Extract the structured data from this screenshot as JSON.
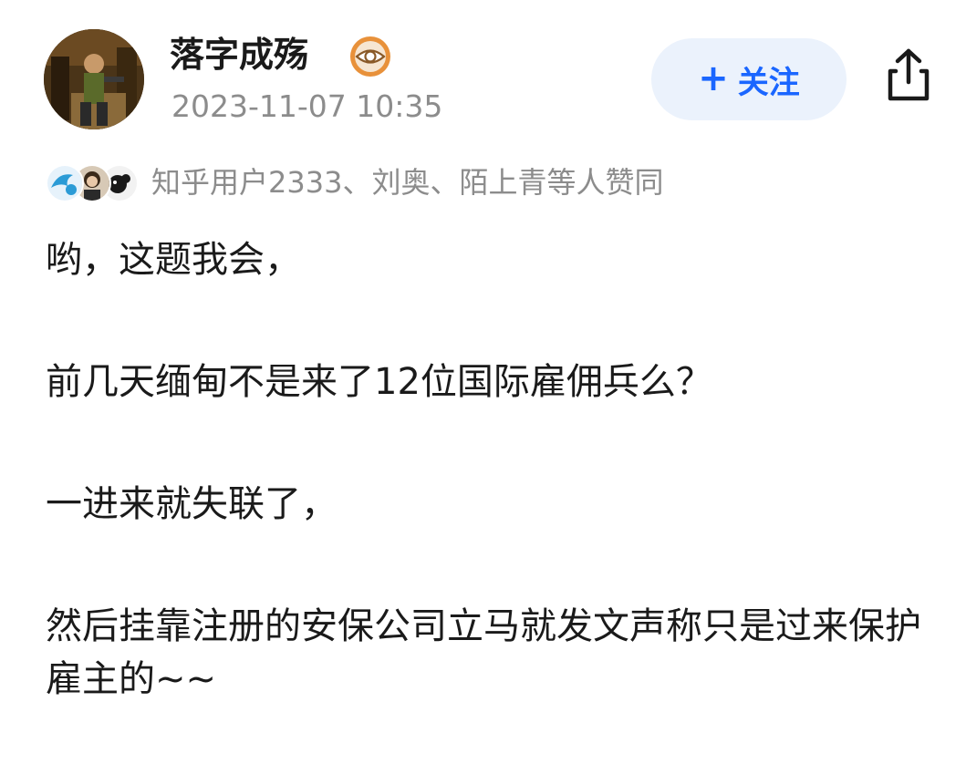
{
  "author": {
    "name": "落字成殇",
    "badge_icon": "eye-badge-icon",
    "timestamp": "2023-11-07 10:35"
  },
  "actions": {
    "follow_label": "关注",
    "follow_icon": "plus-icon",
    "share_icon": "share-icon"
  },
  "likers": {
    "text": "知乎用户2333、刘奥、陌上青等人赞同"
  },
  "content": {
    "paragraphs": [
      "哟，这题我会，",
      "前几天缅甸不是来了12位国际雇佣兵么？",
      "一进来就失联了，",
      "然后挂靠注册的安保公司立马就发文声称只是过来保护雇主的~~"
    ]
  },
  "colors": {
    "accent": "#1a66ff",
    "follow_bg": "#ebf2fc",
    "muted_text": "#8c8c8c",
    "body_text": "#1a1a1a",
    "badge": "#e8913a"
  }
}
